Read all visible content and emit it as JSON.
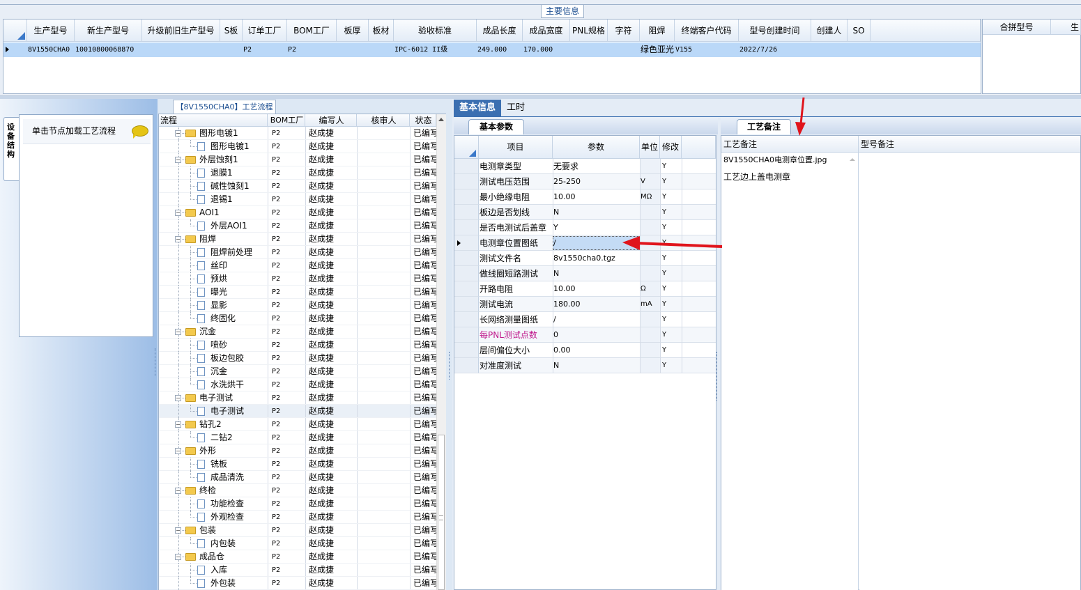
{
  "main_info": {
    "group_title": "主要信息",
    "columns": [
      "生产型号",
      "新生产型号",
      "升级前旧生产型号",
      "S板",
      "订单工厂",
      "BOM工厂",
      "板厚",
      "板材",
      "验收标准",
      "成品长度",
      "成品宽度",
      "PNL规格",
      "字符",
      "阻焊",
      "终端客户代码",
      "型号创建时间",
      "创建人",
      "SO"
    ],
    "row": [
      "8V1550CHA0",
      "10010800068870",
      "",
      "",
      "P2",
      "P2",
      "",
      "",
      "IPC-6012 II级",
      "249.000",
      "170.000",
      "",
      "",
      "绿色亚光",
      "V155",
      "2022/7/26",
      "",
      ""
    ],
    "side_columns": [
      "合拼型号",
      "生"
    ]
  },
  "left_panel": {
    "vertical_tab": "设备结构",
    "tip_text": "单击节点加载工艺流程"
  },
  "flow": {
    "title": "【8V1550CHA0】工艺流程",
    "columns": [
      "流程",
      "BOM工厂",
      "编写人",
      "核审人",
      "状态"
    ],
    "rows": [
      {
        "level": 0,
        "name": "图形电镀1",
        "bom": "P2",
        "writer": "赵成捷",
        "status": "已编写"
      },
      {
        "level": 1,
        "name": "图形电镀1",
        "bom": "P2",
        "writer": "赵成捷",
        "status": "已编写"
      },
      {
        "level": 0,
        "name": "外层蚀刻1",
        "bom": "P2",
        "writer": "赵成捷",
        "status": "已编写"
      },
      {
        "level": 1,
        "name": "退膜1",
        "bom": "P2",
        "writer": "赵成捷",
        "status": "已编写"
      },
      {
        "level": 1,
        "name": "碱性蚀刻1",
        "bom": "P2",
        "writer": "赵成捷",
        "status": "已编写"
      },
      {
        "level": 1,
        "name": "退锡1",
        "bom": "P2",
        "writer": "赵成捷",
        "status": "已编写"
      },
      {
        "level": 0,
        "name": "AOI1",
        "bom": "P2",
        "writer": "赵成捷",
        "status": "已编写"
      },
      {
        "level": 1,
        "name": "外层AOI1",
        "bom": "P2",
        "writer": "赵成捷",
        "status": "已编写"
      },
      {
        "level": 0,
        "name": "阻焊",
        "bom": "P2",
        "writer": "赵成捷",
        "status": "已编写"
      },
      {
        "level": 1,
        "name": "阻焊前处理",
        "bom": "P2",
        "writer": "赵成捷",
        "status": "已编写"
      },
      {
        "level": 1,
        "name": "丝印",
        "bom": "P2",
        "writer": "赵成捷",
        "status": "已编写"
      },
      {
        "level": 1,
        "name": "预烘",
        "bom": "P2",
        "writer": "赵成捷",
        "status": "已编写"
      },
      {
        "level": 1,
        "name": "曝光",
        "bom": "P2",
        "writer": "赵成捷",
        "status": "已编写"
      },
      {
        "level": 1,
        "name": "显影",
        "bom": "P2",
        "writer": "赵成捷",
        "status": "已编写"
      },
      {
        "level": 1,
        "name": "终固化",
        "bom": "P2",
        "writer": "赵成捷",
        "status": "已编写"
      },
      {
        "level": 0,
        "name": "沉金",
        "bom": "P2",
        "writer": "赵成捷",
        "status": "已编写"
      },
      {
        "level": 1,
        "name": "喷砂",
        "bom": "P2",
        "writer": "赵成捷",
        "status": "已编写"
      },
      {
        "level": 1,
        "name": "板边包胶",
        "bom": "P2",
        "writer": "赵成捷",
        "status": "已编写"
      },
      {
        "level": 1,
        "name": "沉金",
        "bom": "P2",
        "writer": "赵成捷",
        "status": "已编写"
      },
      {
        "level": 1,
        "name": "水洗烘干",
        "bom": "P2",
        "writer": "赵成捷",
        "status": "已编写"
      },
      {
        "level": 0,
        "name": "电子测试",
        "bom": "P2",
        "writer": "赵成捷",
        "status": "已编写"
      },
      {
        "level": 1,
        "name": "电子测试",
        "bom": "P2",
        "writer": "赵成捷",
        "status": "已编写",
        "selected": true
      },
      {
        "level": 0,
        "name": "钻孔2",
        "bom": "P2",
        "writer": "赵成捷",
        "status": "已编写"
      },
      {
        "level": 1,
        "name": "二钻2",
        "bom": "P2",
        "writer": "赵成捷",
        "status": "已编写"
      },
      {
        "level": 0,
        "name": "外形",
        "bom": "P2",
        "writer": "赵成捷",
        "status": "已编写"
      },
      {
        "level": 1,
        "name": "铣板",
        "bom": "P2",
        "writer": "赵成捷",
        "status": "已编写"
      },
      {
        "level": 1,
        "name": "成品清洗",
        "bom": "P2",
        "writer": "赵成捷",
        "status": "已编写"
      },
      {
        "level": 0,
        "name": "终检",
        "bom": "P2",
        "writer": "赵成捷",
        "status": "已编写"
      },
      {
        "level": 1,
        "name": "功能检查",
        "bom": "P2",
        "writer": "赵成捷",
        "status": "已编写"
      },
      {
        "level": 1,
        "name": "外观检查",
        "bom": "P2",
        "writer": "赵成捷",
        "status": "已编写"
      },
      {
        "level": 0,
        "name": "包装",
        "bom": "P2",
        "writer": "赵成捷",
        "status": "已编写"
      },
      {
        "level": 1,
        "name": "内包装",
        "bom": "P2",
        "writer": "赵成捷",
        "status": "已编写"
      },
      {
        "level": 0,
        "name": "成品仓",
        "bom": "P2",
        "writer": "赵成捷",
        "status": "已编写"
      },
      {
        "level": 1,
        "name": "入库",
        "bom": "P2",
        "writer": "赵成捷",
        "status": "已编写"
      },
      {
        "level": 1,
        "name": "外包装",
        "bom": "P2",
        "writer": "赵成捷",
        "status": "已编写"
      }
    ]
  },
  "tabs": {
    "basic_info": "基本信息",
    "work_hours": "工时"
  },
  "params": {
    "sub_tab": "基本参数",
    "columns": [
      "项目",
      "参数",
      "单位",
      "修改"
    ],
    "rows": [
      {
        "item": "电测章类型",
        "value": "无要求",
        "unit": "",
        "mod": "Y"
      },
      {
        "item": "测试电压范围",
        "value": "25-250",
        "unit": "V",
        "mod": "Y"
      },
      {
        "item": "最小绝缘电阻",
        "value": "10.00",
        "unit": "MΩ",
        "mod": "Y"
      },
      {
        "item": "板边是否划线",
        "value": "N",
        "unit": "",
        "mod": "Y"
      },
      {
        "item": "是否电测试后盖章",
        "value": "Y",
        "unit": "",
        "mod": "Y"
      },
      {
        "item": "电测章位置图纸",
        "value": "/",
        "unit": "",
        "mod": "Y",
        "current": true
      },
      {
        "item": "测试文件名",
        "value": "8v1550cha0.tgz",
        "unit": "",
        "mod": "Y"
      },
      {
        "item": "做线圈短路测试",
        "value": "N",
        "unit": "",
        "mod": "Y"
      },
      {
        "item": "开路电阻",
        "value": "10.00",
        "unit": "Ω",
        "mod": "Y"
      },
      {
        "item": "测试电流",
        "value": "180.00",
        "unit": "mA",
        "mod": "Y"
      },
      {
        "item": "长网络测量图纸",
        "value": "/",
        "unit": "",
        "mod": "Y"
      },
      {
        "item": "每PNL测试点数",
        "value": "0",
        "unit": "",
        "mod": "Y",
        "highlight": true
      },
      {
        "item": "层间偏位大小",
        "value": "0.00",
        "unit": "",
        "mod": "Y"
      },
      {
        "item": "对准度测试",
        "value": "N",
        "unit": "",
        "mod": "Y"
      }
    ],
    "highlight_color": "#c0198c"
  },
  "notes": {
    "tab": "工艺备注",
    "col1": "工艺备注",
    "col2": "型号备注",
    "line1": "8V1550CHA0电测章位置.jpg",
    "line2": "工艺边上盖电测章"
  }
}
